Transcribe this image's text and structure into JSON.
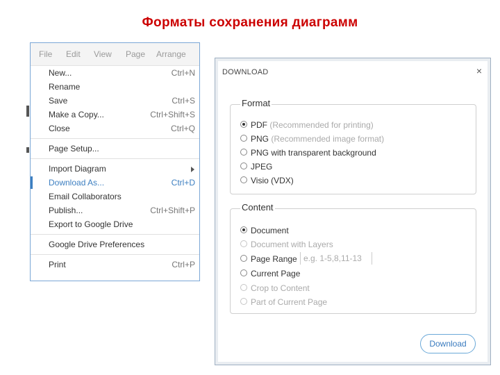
{
  "slide": {
    "title": "Форматы сохранения диаграмм"
  },
  "menubar": [
    "File",
    "Edit",
    "View",
    "Page",
    "Arrange"
  ],
  "file_menu": {
    "new": {
      "label": "New...",
      "shortcut": "Ctrl+N"
    },
    "rename": {
      "label": "Rename"
    },
    "save": {
      "label": "Save",
      "shortcut": "Ctrl+S"
    },
    "make_copy": {
      "label": "Make a Copy...",
      "shortcut": "Ctrl+Shift+S"
    },
    "close": {
      "label": "Close",
      "shortcut": "Ctrl+Q"
    },
    "page_setup": {
      "label": "Page Setup..."
    },
    "import_diagram": {
      "label": "Import Diagram"
    },
    "download_as": {
      "label": "Download As...",
      "shortcut": "Ctrl+D"
    },
    "email_collaborators": {
      "label": "Email Collaborators"
    },
    "publish": {
      "label": "Publish...",
      "shortcut": "Ctrl+Shift+P"
    },
    "export_drive": {
      "label": "Export to Google Drive"
    },
    "drive_prefs": {
      "label": "Google Drive Preferences"
    },
    "print": {
      "label": "Print",
      "shortcut": "Ctrl+P"
    }
  },
  "dialog": {
    "title": "DOWNLOAD",
    "close_glyph": "×",
    "format": {
      "heading": "Format",
      "pdf": {
        "label": "PDF",
        "hint": "(Recommended for printing)"
      },
      "png": {
        "label": "PNG",
        "hint": "(Recommended image format)"
      },
      "png_transparent": {
        "label": "PNG with transparent background"
      },
      "jpeg": {
        "label": "JPEG"
      },
      "visio": {
        "label": "Visio (VDX)"
      },
      "selected": "PDF"
    },
    "content": {
      "heading": "Content",
      "document": "Document",
      "document_layers": "Document with Layers",
      "page_range": "Page Range",
      "page_range_placeholder": "e.g. 1-5,8,11-13",
      "current_page": "Current Page",
      "crop_to_content": "Crop to Content",
      "part_of_current_page": "Part of Current Page",
      "selected": "Document"
    },
    "download_button": "Download"
  },
  "colors": {
    "title": "#cc0000",
    "accent": "#3d7fc1",
    "button_border": "#6aa8d8"
  }
}
